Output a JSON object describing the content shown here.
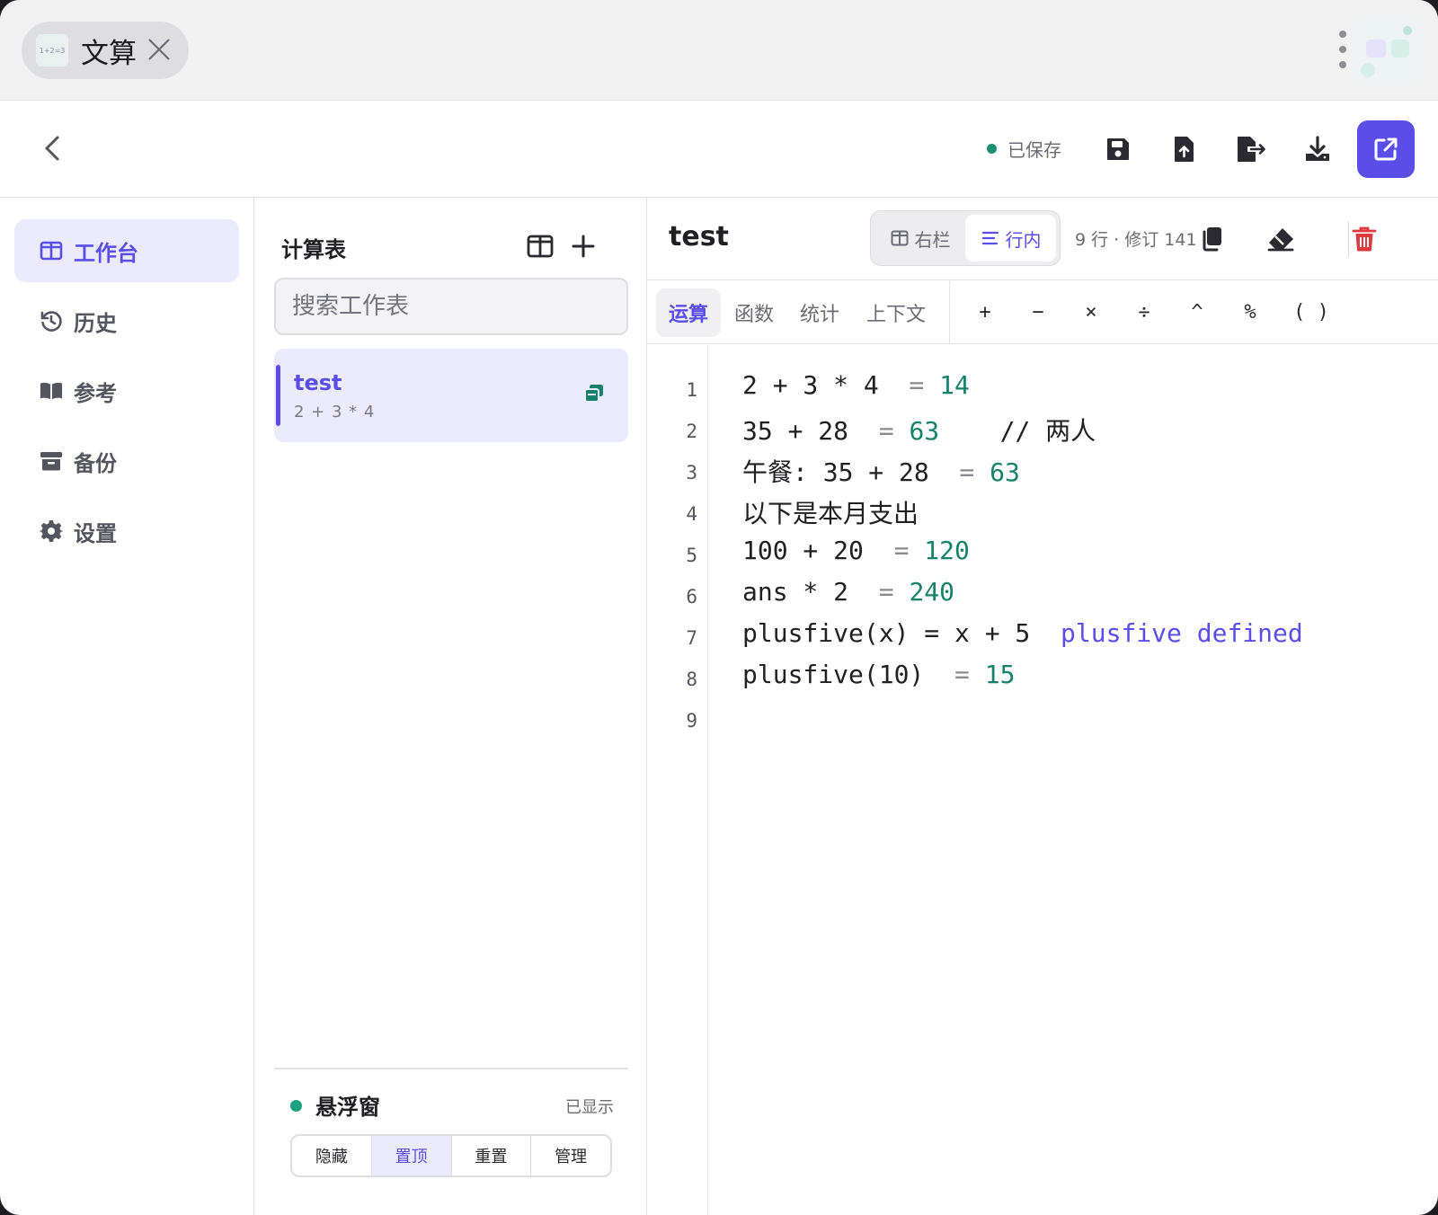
{
  "app": {
    "tab_title": "文算",
    "tab_thumb_text": "1+2=3",
    "preview_text": "1+2 = 3"
  },
  "toolbar": {
    "save_status": "已保存"
  },
  "nav": {
    "items": [
      {
        "label": "工作台",
        "icon": "columns-icon"
      },
      {
        "label": "历史",
        "icon": "history-icon"
      },
      {
        "label": "参考",
        "icon": "book-icon"
      },
      {
        "label": "备份",
        "icon": "archive-icon"
      },
      {
        "label": "设置",
        "icon": "gear-icon"
      }
    ]
  },
  "sheets": {
    "title": "计算表",
    "search_placeholder": "搜索工作表",
    "items": [
      {
        "name": "test",
        "preview": "2 + 3 * 4"
      }
    ]
  },
  "floating": {
    "title": "悬浮窗",
    "status": "已显示",
    "buttons": [
      "隐藏",
      "置顶",
      "重置",
      "管理"
    ],
    "active_button": "置顶"
  },
  "editor": {
    "title": "test",
    "view_modes": [
      "右栏",
      "行内"
    ],
    "active_view": "行内",
    "meta": "9 行 · 修订 141",
    "categories": [
      "运算",
      "函数",
      "统计",
      "上下文"
    ],
    "active_category": "运算",
    "operators": [
      "+",
      "−",
      "×",
      "÷",
      "^",
      "%",
      "( )"
    ],
    "lines": [
      {
        "no": "1",
        "expr": "2 + 3 * 4",
        "result": "14"
      },
      {
        "no": "2",
        "expr": "35 + 28",
        "result": "63",
        "comment": "// 两人"
      },
      {
        "no": "3",
        "expr": "午餐: 35 + 28",
        "result": "63"
      },
      {
        "no": "4",
        "expr": "以下是本月支出"
      },
      {
        "no": "5",
        "expr": "100 + 20",
        "result": "120"
      },
      {
        "no": "6",
        "expr": "ans * 2",
        "result": "240"
      },
      {
        "no": "7",
        "expr": "plusfive(x) = x + 5",
        "note": "plusfive defined"
      },
      {
        "no": "8",
        "expr": "plusfive(10)",
        "result": "15"
      },
      {
        "no": "9",
        "expr": ""
      }
    ]
  },
  "colors": {
    "accent": "#5b4de8",
    "result": "#16826a",
    "saved_dot": "#1c8f74",
    "danger": "#e0393e"
  }
}
